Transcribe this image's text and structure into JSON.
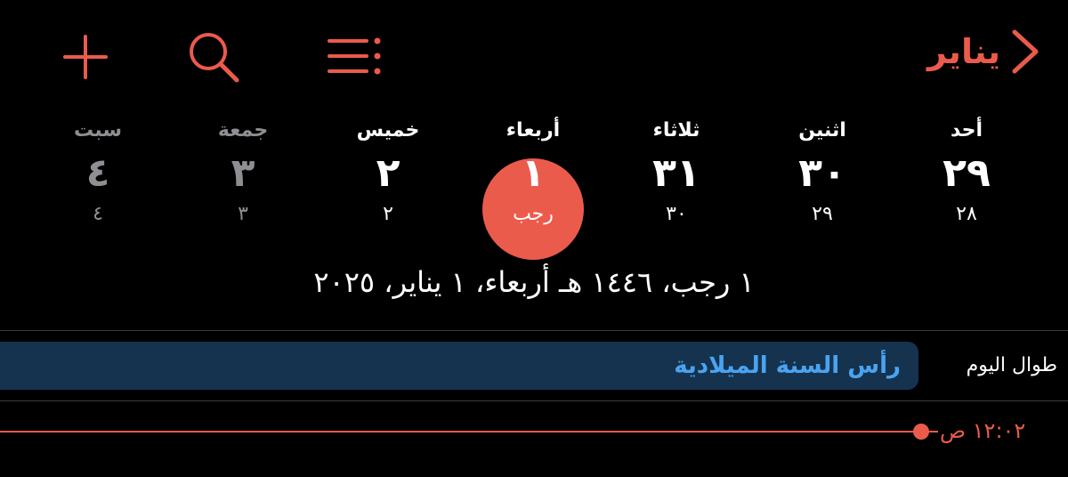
{
  "header": {
    "back_label": "يناير",
    "add_icon": "plus-icon",
    "search_icon": "search-icon",
    "list_icon": "list-icon",
    "back_icon": "chevron-right-icon",
    "accent_color": "#EA5B4B"
  },
  "week": [
    {
      "name": "أحد",
      "num": "٢٩",
      "hijri": "٢٨"
    },
    {
      "name": "اثنين",
      "num": "٣٠",
      "hijri": "٢٩"
    },
    {
      "name": "ثلاثاء",
      "num": "٣١",
      "hijri": "٣٠"
    },
    {
      "name": "أربعاء",
      "num": "١",
      "hijri": "رجب"
    },
    {
      "name": "خميس",
      "num": "٢",
      "hijri": "٢"
    },
    {
      "name": "جمعة",
      "num": "٣",
      "hijri": "٣"
    },
    {
      "name": "سبت",
      "num": "٤",
      "hijri": "٤"
    }
  ],
  "full_date": "١ رجب، ١٤٤٦ هـ  أربعاء، ١ يناير، ٢٠٢٥",
  "all_day": {
    "label": "طوال اليوم",
    "event_title": "رأس السنة الميلادية",
    "event_color": "#15334E"
  },
  "now": {
    "time": "١٢:٠٢ ص"
  }
}
